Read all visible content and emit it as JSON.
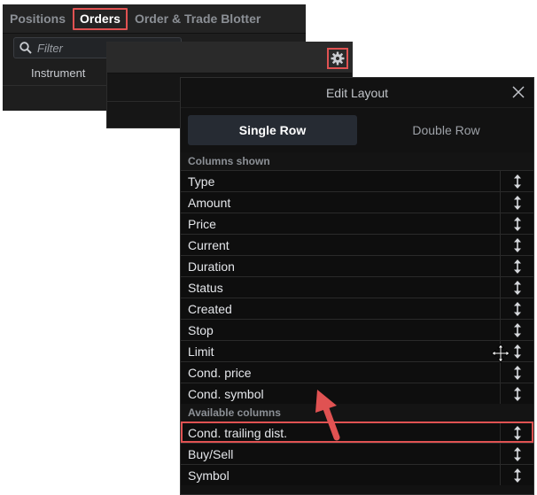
{
  "tabs": [
    "Positions",
    "Orders",
    "Order & Trade Blotter"
  ],
  "filter": {
    "placeholder": "Filter"
  },
  "columns_header": "Instrument",
  "dialog": {
    "title": "Edit Layout",
    "modes": [
      "Single Row",
      "Double Row"
    ],
    "shown_label": "Columns shown",
    "shown": [
      "Type",
      "Amount",
      "Price",
      "Current",
      "Duration",
      "Status",
      "Created",
      "Stop",
      "Limit",
      "Cond. price",
      "Cond. symbol"
    ],
    "available_label": "Available columns",
    "available": [
      "Cond. trailing dist.",
      "Buy/Sell",
      "Symbol"
    ]
  },
  "colors": {
    "highlight": "#e05252",
    "background": "#121212",
    "active_segment": "#262b33"
  },
  "icons": [
    "search-icon",
    "gear-icon",
    "close-icon",
    "drag-handle-icon",
    "move-cursor-icon",
    "pointer-arrow-icon"
  ]
}
